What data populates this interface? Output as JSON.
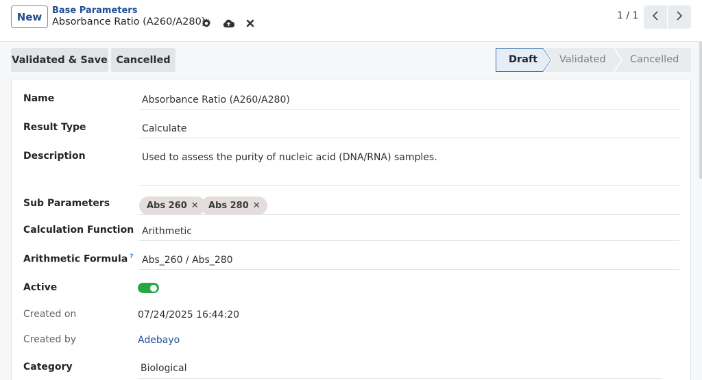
{
  "header": {
    "new_label": "New",
    "breadcrumb": "Base Parameters",
    "record_title": "Absorbance Ratio (A260/A280)",
    "icons": [
      "gear-icon",
      "cloud-upload-icon",
      "close-icon"
    ]
  },
  "pager": {
    "value": "1 / 1"
  },
  "actions": {
    "validate_save": "Validated & Save",
    "cancelled": "Cancelled"
  },
  "statusbar": {
    "stages": [
      {
        "label": "Draft",
        "active": true
      },
      {
        "label": "Validated",
        "active": false
      },
      {
        "label": "Cancelled",
        "active": false
      }
    ]
  },
  "form": {
    "name": {
      "label": "Name",
      "value": "Absorbance Ratio (A260/A280)"
    },
    "result_type": {
      "label": "Result Type",
      "value": "Calculate"
    },
    "description": {
      "label": "Description",
      "value": "Used to assess the purity of nucleic acid (DNA/RNA) samples."
    },
    "sub_parameters": {
      "label": "Sub Parameters",
      "tags": [
        "Abs 260",
        "Abs 280"
      ]
    },
    "calculation_function": {
      "label": "Calculation Function",
      "value": "Arithmetic"
    },
    "arithmetic_formula": {
      "label": "Arithmetic Formula",
      "help": "?",
      "value": "Abs_260 / Abs_280"
    },
    "active": {
      "label": "Active",
      "value": true
    },
    "created_on": {
      "label": "Created on",
      "value": "07/24/2025 16:44:20"
    },
    "created_by": {
      "label": "Created by",
      "value": "Adebayo"
    },
    "category": {
      "label": "Category",
      "value": "Biological"
    }
  },
  "colors": {
    "accent": "#1f4e96",
    "toggle_on": "#28a745",
    "tag_bg": "#e5dcdc",
    "active_stage_bg": "#e6edf7"
  }
}
